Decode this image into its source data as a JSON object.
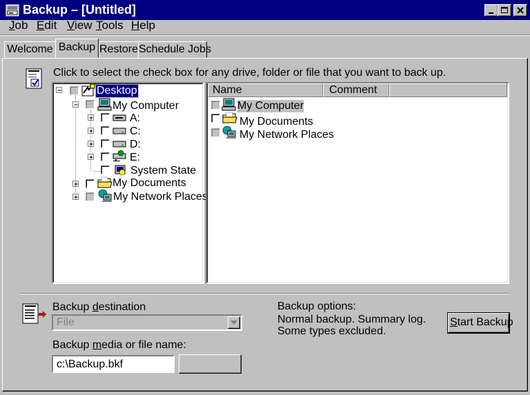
{
  "window": {
    "title": "Backup – [Untitled]",
    "controls": [
      "minimize-icon",
      "maximize-icon",
      "close-icon"
    ]
  },
  "menu": [
    {
      "label": "Job",
      "accel": "J",
      "rest": "ob"
    },
    {
      "label": "Edit",
      "accel": "E",
      "rest": "dit"
    },
    {
      "label": "View",
      "accel": "V",
      "rest": "iew"
    },
    {
      "label": "Tools",
      "accel": "T",
      "rest": "ools"
    },
    {
      "label": "Help",
      "accel": "H",
      "rest": "elp"
    }
  ],
  "tabs": [
    {
      "label": "Welcome",
      "active": false
    },
    {
      "label": "Backup",
      "active": true
    },
    {
      "label": "Restore",
      "active": false
    },
    {
      "label": "Schedule Jobs",
      "active": false
    }
  ],
  "instructions": "Click to select the check box for any drive, folder or file that you want to back up.",
  "tree": {
    "root": "Desktop",
    "items": [
      {
        "label": "My Computer",
        "icon": "computer-icon"
      },
      {
        "label": "A:",
        "icon": "floppy-drive-icon"
      },
      {
        "label": "C:",
        "icon": "hard-drive-icon"
      },
      {
        "label": "D:",
        "icon": "hard-drive-icon"
      },
      {
        "label": "E:",
        "icon": "network-drive-icon"
      },
      {
        "label": "System State",
        "icon": "system-state-icon"
      },
      {
        "label": "My Documents",
        "icon": "folder-icon"
      },
      {
        "label": "My Network Places",
        "icon": "network-places-icon"
      }
    ]
  },
  "list": {
    "columns": [
      "Name",
      "Comment"
    ],
    "rows": [
      {
        "name": "My Computer",
        "icon": "computer-icon"
      },
      {
        "name": "My Documents",
        "icon": "folder-icon"
      },
      {
        "name": "My Network Places",
        "icon": "network-places-icon"
      }
    ]
  },
  "destination": {
    "label_pre": "Backup ",
    "label_accel": "d",
    "label_post": "estination",
    "value": "File"
  },
  "media": {
    "label_pre": "Backup ",
    "label_accel": "m",
    "label_post": "edia or file name:",
    "value": "c:\\Backup.bkf"
  },
  "options": {
    "title": "Backup options:",
    "line1": "Normal backup.  Summary log.",
    "line2": "Some types excluded."
  },
  "start_button": {
    "accel": "S",
    "rest": "tart Backup"
  },
  "colors": {
    "titlebar": "#000080",
    "face": "#c0c0c0",
    "highlight": "#000080"
  }
}
